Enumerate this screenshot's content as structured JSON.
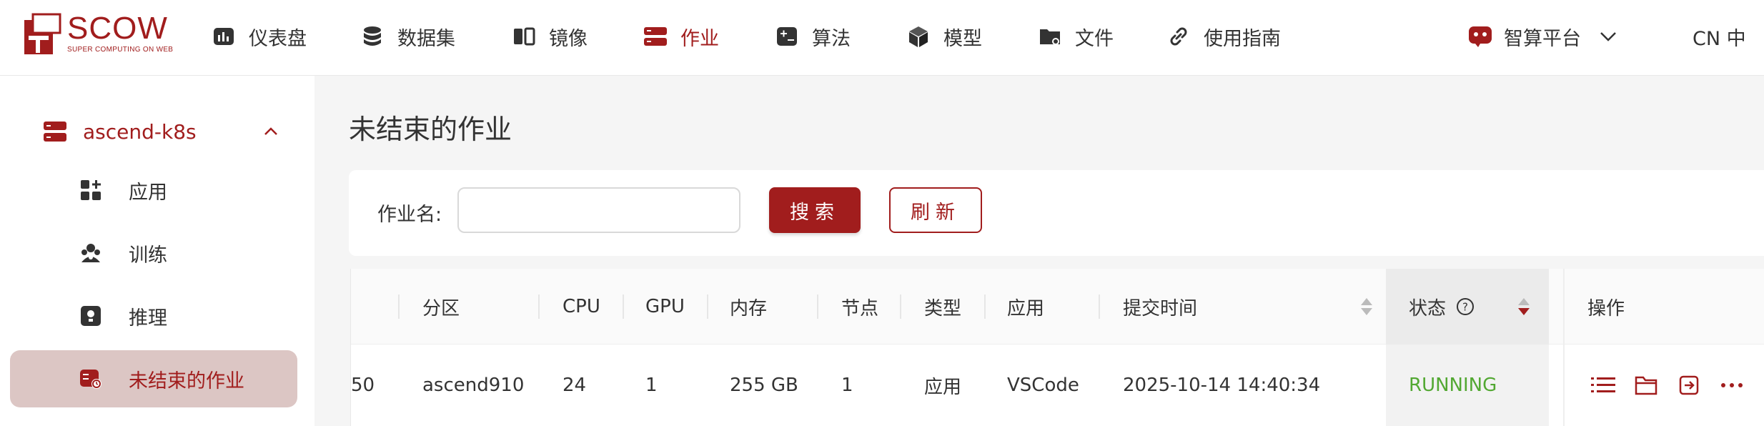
{
  "brand": {
    "name": "SCOW",
    "tagline": "SUPER COMPUTING ON WEB",
    "color": "#a11d1d"
  },
  "nav": [
    {
      "label": "仪表盘",
      "icon": "dashboard-icon"
    },
    {
      "label": "数据集",
      "icon": "database-icon"
    },
    {
      "label": "镜像",
      "icon": "image-icon"
    },
    {
      "label": "作业",
      "icon": "job-icon",
      "active": true
    },
    {
      "label": "算法",
      "icon": "algorithm-icon"
    },
    {
      "label": "模型",
      "icon": "model-cube-icon"
    },
    {
      "label": "文件",
      "icon": "folder-icon"
    },
    {
      "label": "使用指南",
      "icon": "link-icon"
    }
  ],
  "platform": {
    "label": "智算平台",
    "icon": "robot-icon"
  },
  "lang": {
    "label": "CN 中"
  },
  "sidebar": {
    "group": {
      "label": "ascend-k8s",
      "icon": "server-icon"
    },
    "items": [
      {
        "label": "应用",
        "icon": "apps-icon"
      },
      {
        "label": "训练",
        "icon": "training-icon"
      },
      {
        "label": "推理",
        "icon": "inference-icon"
      },
      {
        "label": "未结束的作业",
        "icon": "running-job-icon",
        "active": true
      }
    ]
  },
  "page": {
    "title": "未结束的作业"
  },
  "search": {
    "label": "作业名:",
    "value": "",
    "placeholder": "",
    "search_btn": "搜索",
    "refresh_btn": "刷新"
  },
  "table": {
    "columns": [
      "分区",
      "CPU",
      "GPU",
      "内存",
      "节点",
      "类型",
      "应用",
      "提交时间",
      "状态",
      "操作"
    ],
    "rows": [
      {
        "id_fragment": "50",
        "partition": "ascend910",
        "cpu": "24",
        "gpu": "1",
        "memory": "255 GB",
        "nodes": "1",
        "type": "应用",
        "app": "VSCode",
        "submit_time": "2025-10-14 14:40:34",
        "status": "RUNNING"
      }
    ]
  },
  "colors": {
    "accent": "#a11d1d",
    "running": "#52a832",
    "active_bg": "#dcc6c4"
  }
}
